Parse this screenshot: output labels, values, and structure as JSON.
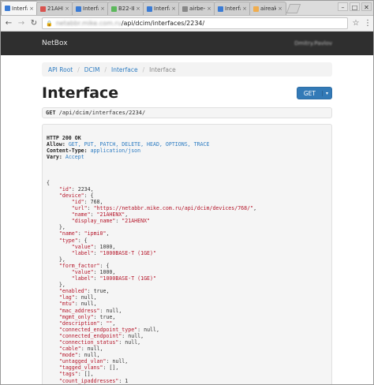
{
  "browser": {
    "tabs": [
      {
        "title": "Interface",
        "color": "#3a7bd5",
        "active": true
      },
      {
        "title": "21AHENX",
        "color": "#d9534f",
        "active": false
      },
      {
        "title": "Interface –",
        "color": "#3a7bd5",
        "active": false
      },
      {
        "title": "B22-IBM",
        "color": "#5cb85c",
        "active": false
      },
      {
        "title": "Interface –",
        "color": "#3a7bd5",
        "active": false
      },
      {
        "title": "airbe-dz1.pr",
        "color": "#888888",
        "active": false
      },
      {
        "title": "Interface –",
        "color": "#3a7bd5",
        "active": false
      },
      {
        "title": "aireaka",
        "color": "#f0ad4e",
        "active": false
      }
    ],
    "window_controls": {
      "minimize": "–",
      "maximize": "□",
      "close": "✕"
    },
    "address": {
      "host": "netabbr.mike.com.ru",
      "path": "/api/dcim/interfaces/2234/"
    }
  },
  "navbar": {
    "brand": "NetBox",
    "user": "Dmitry.Pavlov"
  },
  "breadcrumb": [
    "API Root",
    "DCIM",
    "Interface",
    "Interface"
  ],
  "page_title": "Interface",
  "get_button": {
    "label": "GET",
    "caret": "▾"
  },
  "request": {
    "method": "GET",
    "path": "/api/dcim/interfaces/2234/"
  },
  "response_headers": {
    "status": "HTTP 200 OK",
    "allow_label": "Allow:",
    "allow_value": "GET, PUT, PATCH, DELETE, HEAD, OPTIONS, TRACE",
    "content_type_label": "Content-Type:",
    "content_type_value": "application/json",
    "vary_label": "Vary:",
    "vary_value": "Accept"
  },
  "json_lines": [
    "{",
    "    \"id\": 2234,",
    "    \"device\": {",
    "        \"id\": 768,",
    "        \"url\": \"https://netabbr.mike.com.ru/api/dcim/devices/768/\",",
    "        \"name\": \"21AHENX\",",
    "        \"display_name\": \"21AHENX\"",
    "    },",
    "    \"name\": \"ipmi0\",",
    "    \"type\": {",
    "        \"value\": 1000,",
    "        \"label\": \"1000BASE-T (1GE)\"",
    "    },",
    "    \"form_factor\": {",
    "        \"value\": 1000,",
    "        \"label\": \"1000BASE-T (1GE)\"",
    "    },",
    "    \"enabled\": true,",
    "    \"lag\": null,",
    "    \"mtu\": null,",
    "    \"mac_address\": null,",
    "    \"mgmt_only\": true,",
    "    \"description\": \"\",",
    "    \"connected_endpoint_type\": null,",
    "    \"connected_endpoint\": null,",
    "    \"connection_status\": null,",
    "    \"cable\": null,",
    "    \"mode\": null,",
    "    \"untagged_vlan\": null,",
    "    \"tagged_vlans\": [],",
    "    \"tags\": [],",
    "    \"count_ipaddresses\": 1",
    "}"
  ]
}
